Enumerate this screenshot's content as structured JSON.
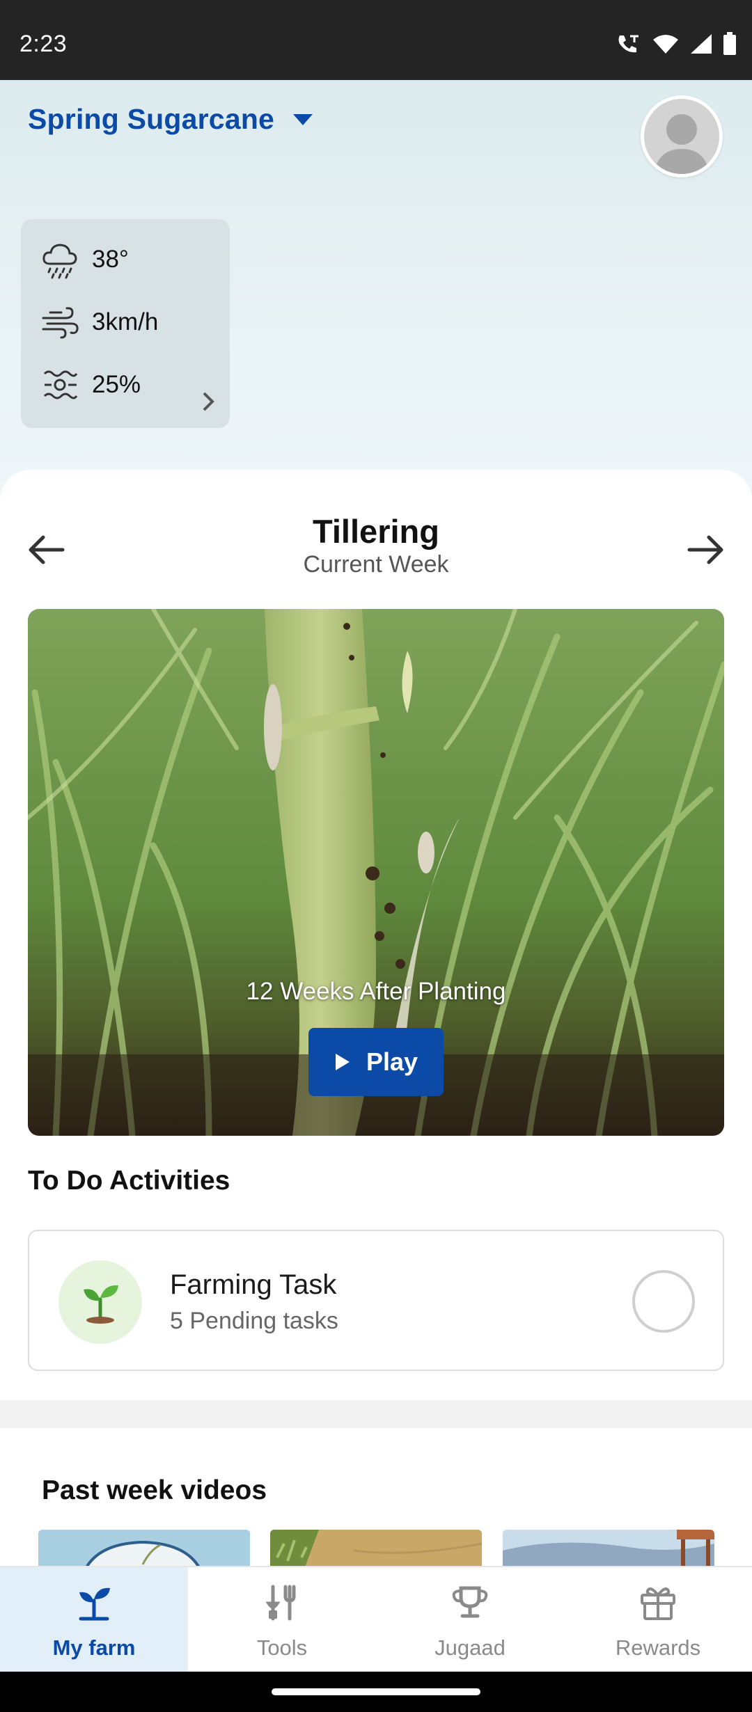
{
  "status_bar": {
    "time": "2:23"
  },
  "header": {
    "crop_name": "Spring Sugarcane",
    "weather": {
      "temperature": "38°",
      "wind": "3km/h",
      "humidity": "25%"
    }
  },
  "stage": {
    "title": "Tillering",
    "subtitle": "Current Week"
  },
  "video": {
    "caption": "12 Weeks After Planting",
    "play_label": "Play"
  },
  "todo": {
    "section_title": "To Do Activities",
    "task": {
      "name": "Farming Task",
      "pending": "5 Pending tasks"
    }
  },
  "past_videos": {
    "section_title": "Past week videos"
  },
  "bottom_nav": {
    "tabs": [
      {
        "label": "My farm",
        "icon": "plant-icon",
        "active": true
      },
      {
        "label": "Tools",
        "icon": "tools-icon",
        "active": false
      },
      {
        "label": "Jugaad",
        "icon": "trophy-icon",
        "active": false
      },
      {
        "label": "Rewards",
        "icon": "gift-icon",
        "active": false
      }
    ]
  },
  "colors": {
    "brand_blue": "#0b4aa6",
    "active_tab_bg": "#e2eef8",
    "task_icon_bg": "#e6f4de"
  }
}
